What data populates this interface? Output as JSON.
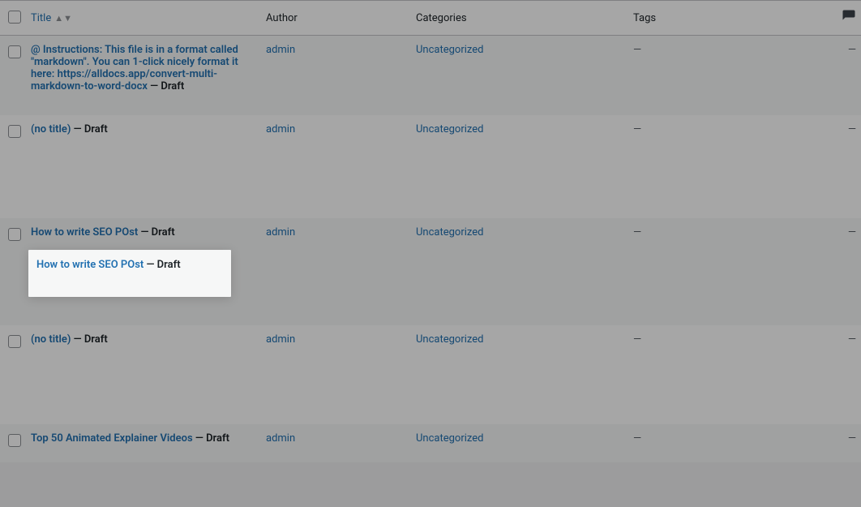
{
  "headers": {
    "title": "Title",
    "author": "Author",
    "categories": "Categories",
    "tags": "Tags"
  },
  "status": {
    "draft_separator": " — ",
    "draft_label": "Draft"
  },
  "rows": [
    {
      "title": "@ Instructions: This file is in a format called \"markdown\". You can 1-click nicely format it here: https://alldocs.app/convert-multi-markdown-to-word-docx",
      "author": "admin",
      "category": "Uncategorized",
      "tags": "—",
      "comments": "—"
    },
    {
      "title": "(no title)",
      "author": "admin",
      "category": "Uncategorized",
      "tags": "—",
      "comments": "—"
    },
    {
      "title": "How to write SEO POst",
      "author": "admin",
      "category": "Uncategorized",
      "tags": "—",
      "comments": "—"
    },
    {
      "title": "(no title)",
      "author": "admin",
      "category": "Uncategorized",
      "tags": "—",
      "comments": "—"
    },
    {
      "title": "Top 50 Animated Explainer Videos",
      "author": "admin",
      "category": "Uncategorized",
      "tags": "—",
      "comments": "—"
    }
  ]
}
